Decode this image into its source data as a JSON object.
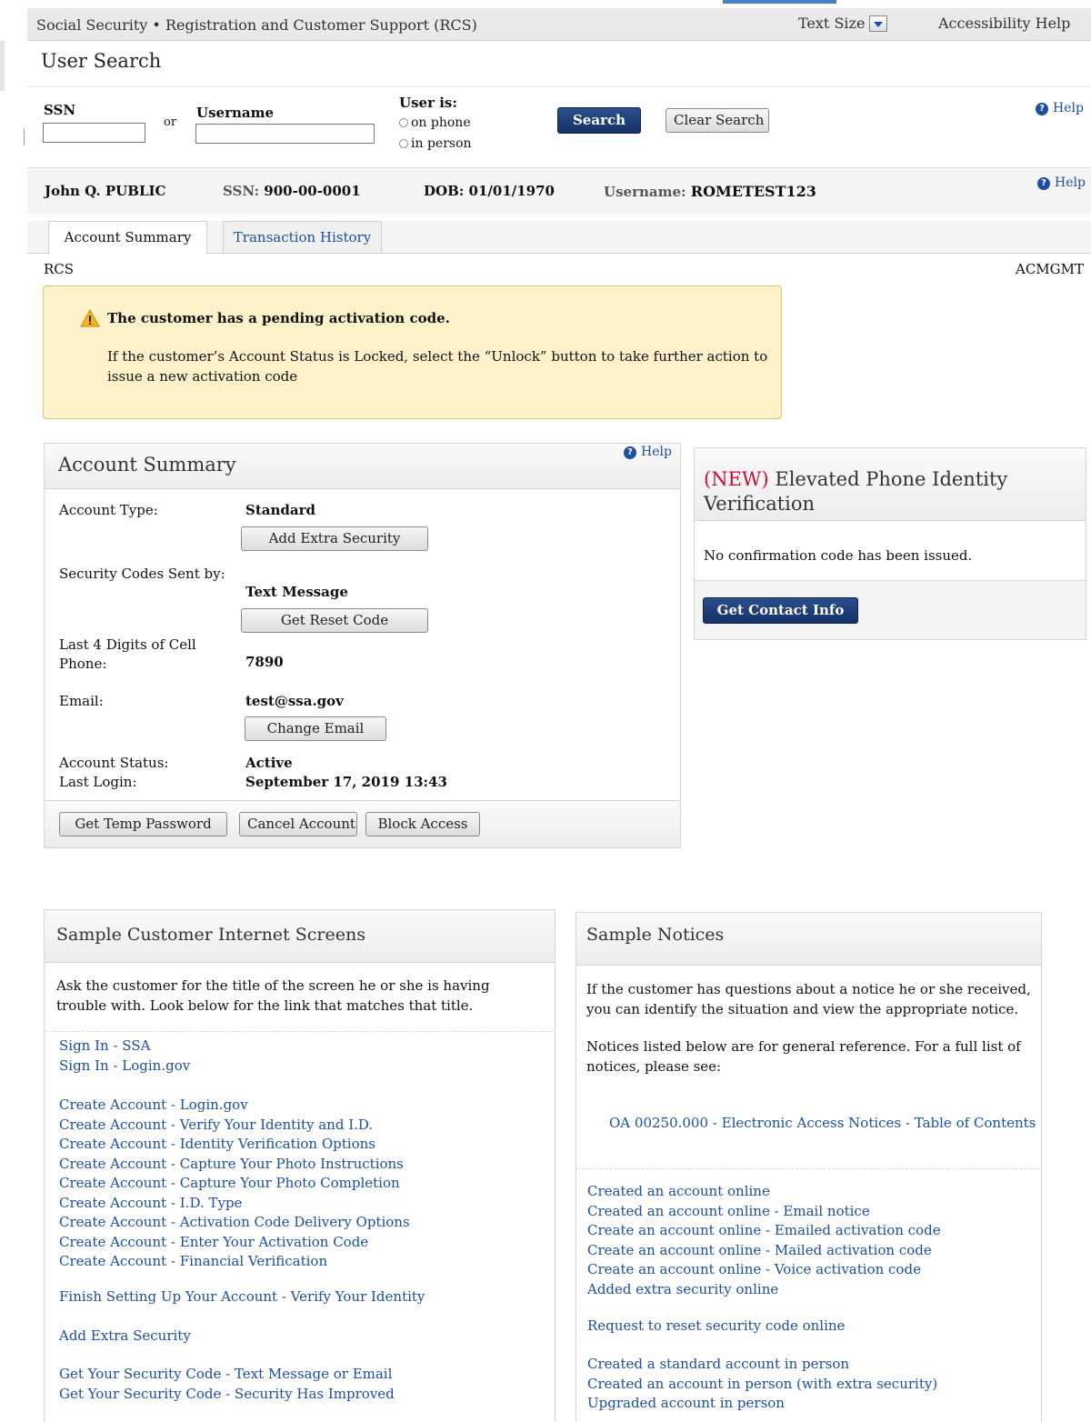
{
  "header": {
    "site_title": "Social Security • Registration and Customer Support (RCS)",
    "text_size_label": "Text Size",
    "accessibility_help": "Accessibility Help"
  },
  "page_title": "User Search",
  "search": {
    "ssn_label": "SSN",
    "or_label": "or",
    "username_label": "Username",
    "user_is_label": "User is:",
    "on_phone_label": "on phone",
    "in_person_label": "in person",
    "search_button": "Search",
    "clear_button": "Clear Search",
    "help": "Help"
  },
  "customer": {
    "name": "John Q. PUBLIC",
    "ssn_label": "SSN:",
    "ssn_value": "900-00-0001",
    "dob_label": "DOB:",
    "dob_value": "01/01/1970",
    "username_label": "Username:",
    "username_value": "ROMETEST123",
    "help": "Help"
  },
  "tabs": [
    {
      "label": "Account Summary",
      "active": true
    },
    {
      "label": "Transaction History",
      "active": false
    }
  ],
  "crumb_left": "RCS",
  "crumb_right": "ACMGMT",
  "alert": {
    "title": "The customer has a pending activation code.",
    "body": "If the customer’s Account Status is Locked, select the “Unlock” button to take further action to issue a new activation code"
  },
  "account_summary": {
    "title": "Account Summary",
    "help": "Help",
    "account_type_label": "Account Type:",
    "account_type_value": "Standard",
    "add_extra_security_button": "Add Extra Security",
    "security_codes_label": "Security Codes Sent by:",
    "security_codes_value": "Text Message",
    "get_reset_code_button": "Get Reset Code",
    "cell_label_line1": "Last 4 Digits of Cell",
    "cell_label_line2": "Phone:",
    "cell_value": "7890",
    "email_label": "Email:",
    "email_value": "test@ssa.gov",
    "change_email_button": "Change Email",
    "status_label": "Account Status:",
    "status_value": "Active",
    "last_login_label": "Last Login:",
    "last_login_value": "September 17, 2019 13:43",
    "footer_buttons": {
      "temp_password": "Get Temp Password",
      "cancel_account": "Cancel Account",
      "block_access": "Block Access"
    }
  },
  "elevated": {
    "new_tag": "(NEW)",
    "title_rest": "Elevated Phone Identity",
    "title_line2": "Verification",
    "body": "No confirmation code has been issued.",
    "button": "Get Contact Info"
  },
  "sample_screens": {
    "title": "Sample Customer Internet Screens",
    "intro": "Ask the customer for the title of the screen he or she is having trouble with. Look below for the link that matches that title.",
    "groups": [
      [
        "Sign In - SSA",
        "Sign In - Login.gov"
      ],
      [
        "Create Account - Login.gov",
        "Create Account - Verify Your Identity and I.D.",
        "Create Account - Identity Verification Options",
        "Create Account - Capture Your Photo Instructions",
        "Create Account - Capture Your Photo Completion",
        "Create Account - I.D. Type",
        "Create Account - Activation Code Delivery Options",
        "Create Account - Enter Your Activation Code",
        "Create Account - Financial Verification"
      ],
      [
        "Finish Setting Up Your Account - Verify Your Identity"
      ],
      [
        "Add Extra Security"
      ],
      [
        "Get Your Security Code - Text Message or Email",
        "Get Your Security Code - Security Has Improved"
      ]
    ]
  },
  "sample_notices": {
    "title": "Sample Notices",
    "intro": "If the customer has questions about a notice he or she received, you can identify the situation and view the appropriate notice.",
    "intro2": "Notices listed below are for general reference. For a full list of notices, please see:",
    "toc_link": "OA 00250.000 - Electronic Access Notices - Table of Contents",
    "groups": [
      [
        "Created an account online",
        "Created an account online - Email notice",
        "Create an account online - Emailed activation code",
        "Create an account online - Mailed activation code",
        "Create an account online - Voice activation code",
        "Added extra security online"
      ],
      [
        "Request to reset security code online"
      ],
      [
        "Created a standard account in person",
        "Created an account in person (with extra security)",
        "Upgraded account in person"
      ]
    ]
  }
}
